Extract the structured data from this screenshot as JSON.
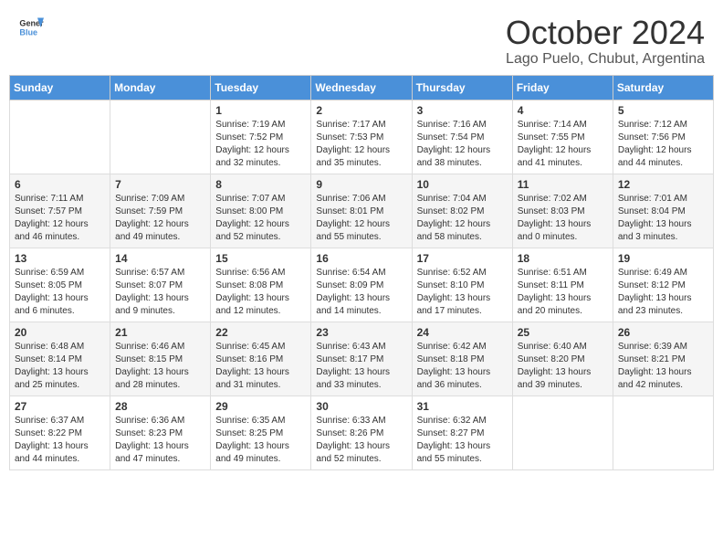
{
  "header": {
    "logo_general": "General",
    "logo_blue": "Blue",
    "month_year": "October 2024",
    "location": "Lago Puelo, Chubut, Argentina"
  },
  "days_of_week": [
    "Sunday",
    "Monday",
    "Tuesday",
    "Wednesday",
    "Thursday",
    "Friday",
    "Saturday"
  ],
  "weeks": [
    [
      {
        "day": "",
        "info": ""
      },
      {
        "day": "",
        "info": ""
      },
      {
        "day": "1",
        "info": "Sunrise: 7:19 AM\nSunset: 7:52 PM\nDaylight: 12 hours and 32 minutes."
      },
      {
        "day": "2",
        "info": "Sunrise: 7:17 AM\nSunset: 7:53 PM\nDaylight: 12 hours and 35 minutes."
      },
      {
        "day": "3",
        "info": "Sunrise: 7:16 AM\nSunset: 7:54 PM\nDaylight: 12 hours and 38 minutes."
      },
      {
        "day": "4",
        "info": "Sunrise: 7:14 AM\nSunset: 7:55 PM\nDaylight: 12 hours and 41 minutes."
      },
      {
        "day": "5",
        "info": "Sunrise: 7:12 AM\nSunset: 7:56 PM\nDaylight: 12 hours and 44 minutes."
      }
    ],
    [
      {
        "day": "6",
        "info": "Sunrise: 7:11 AM\nSunset: 7:57 PM\nDaylight: 12 hours and 46 minutes."
      },
      {
        "day": "7",
        "info": "Sunrise: 7:09 AM\nSunset: 7:59 PM\nDaylight: 12 hours and 49 minutes."
      },
      {
        "day": "8",
        "info": "Sunrise: 7:07 AM\nSunset: 8:00 PM\nDaylight: 12 hours and 52 minutes."
      },
      {
        "day": "9",
        "info": "Sunrise: 7:06 AM\nSunset: 8:01 PM\nDaylight: 12 hours and 55 minutes."
      },
      {
        "day": "10",
        "info": "Sunrise: 7:04 AM\nSunset: 8:02 PM\nDaylight: 12 hours and 58 minutes."
      },
      {
        "day": "11",
        "info": "Sunrise: 7:02 AM\nSunset: 8:03 PM\nDaylight: 13 hours and 0 minutes."
      },
      {
        "day": "12",
        "info": "Sunrise: 7:01 AM\nSunset: 8:04 PM\nDaylight: 13 hours and 3 minutes."
      }
    ],
    [
      {
        "day": "13",
        "info": "Sunrise: 6:59 AM\nSunset: 8:05 PM\nDaylight: 13 hours and 6 minutes."
      },
      {
        "day": "14",
        "info": "Sunrise: 6:57 AM\nSunset: 8:07 PM\nDaylight: 13 hours and 9 minutes."
      },
      {
        "day": "15",
        "info": "Sunrise: 6:56 AM\nSunset: 8:08 PM\nDaylight: 13 hours and 12 minutes."
      },
      {
        "day": "16",
        "info": "Sunrise: 6:54 AM\nSunset: 8:09 PM\nDaylight: 13 hours and 14 minutes."
      },
      {
        "day": "17",
        "info": "Sunrise: 6:52 AM\nSunset: 8:10 PM\nDaylight: 13 hours and 17 minutes."
      },
      {
        "day": "18",
        "info": "Sunrise: 6:51 AM\nSunset: 8:11 PM\nDaylight: 13 hours and 20 minutes."
      },
      {
        "day": "19",
        "info": "Sunrise: 6:49 AM\nSunset: 8:12 PM\nDaylight: 13 hours and 23 minutes."
      }
    ],
    [
      {
        "day": "20",
        "info": "Sunrise: 6:48 AM\nSunset: 8:14 PM\nDaylight: 13 hours and 25 minutes."
      },
      {
        "day": "21",
        "info": "Sunrise: 6:46 AM\nSunset: 8:15 PM\nDaylight: 13 hours and 28 minutes."
      },
      {
        "day": "22",
        "info": "Sunrise: 6:45 AM\nSunset: 8:16 PM\nDaylight: 13 hours and 31 minutes."
      },
      {
        "day": "23",
        "info": "Sunrise: 6:43 AM\nSunset: 8:17 PM\nDaylight: 13 hours and 33 minutes."
      },
      {
        "day": "24",
        "info": "Sunrise: 6:42 AM\nSunset: 8:18 PM\nDaylight: 13 hours and 36 minutes."
      },
      {
        "day": "25",
        "info": "Sunrise: 6:40 AM\nSunset: 8:20 PM\nDaylight: 13 hours and 39 minutes."
      },
      {
        "day": "26",
        "info": "Sunrise: 6:39 AM\nSunset: 8:21 PM\nDaylight: 13 hours and 42 minutes."
      }
    ],
    [
      {
        "day": "27",
        "info": "Sunrise: 6:37 AM\nSunset: 8:22 PM\nDaylight: 13 hours and 44 minutes."
      },
      {
        "day": "28",
        "info": "Sunrise: 6:36 AM\nSunset: 8:23 PM\nDaylight: 13 hours and 47 minutes."
      },
      {
        "day": "29",
        "info": "Sunrise: 6:35 AM\nSunset: 8:25 PM\nDaylight: 13 hours and 49 minutes."
      },
      {
        "day": "30",
        "info": "Sunrise: 6:33 AM\nSunset: 8:26 PM\nDaylight: 13 hours and 52 minutes."
      },
      {
        "day": "31",
        "info": "Sunrise: 6:32 AM\nSunset: 8:27 PM\nDaylight: 13 hours and 55 minutes."
      },
      {
        "day": "",
        "info": ""
      },
      {
        "day": "",
        "info": ""
      }
    ]
  ]
}
